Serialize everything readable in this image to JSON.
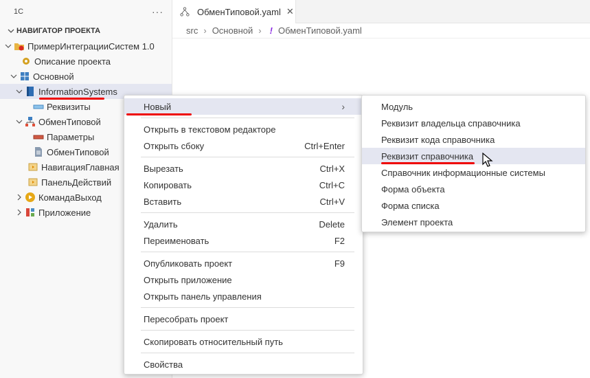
{
  "sidebar": {
    "header": "1С",
    "more": "···",
    "section": "НАВИГАТОР ПРОЕКТА",
    "tree": [
      {
        "label": "ПримерИнтеграцииСистем 1.0"
      },
      {
        "label": "Описание проекта"
      },
      {
        "label": "Основной"
      },
      {
        "label": "InformationSystems"
      },
      {
        "label": "Реквизиты"
      },
      {
        "label": "ОбменТиповой"
      },
      {
        "label": "Параметры"
      },
      {
        "label": "ОбменТиповой"
      },
      {
        "label": "НавигацияГлавная"
      },
      {
        "label": "ПанельДействий"
      },
      {
        "label": "КомандаВыход"
      },
      {
        "label": "Приложение"
      }
    ]
  },
  "tab": {
    "label": "ОбменТиповой.yaml"
  },
  "breadcrumb": {
    "a": "src",
    "b": "Основной",
    "mark": "!",
    "c": "ОбменТиповой.yaml"
  },
  "menu": {
    "new": "Новый",
    "open_text": "Открыть в текстовом редакторе",
    "open_side": "Открыть сбоку",
    "open_side_key": "Ctrl+Enter",
    "cut": "Вырезать",
    "cut_key": "Ctrl+X",
    "copy": "Копировать",
    "copy_key": "Ctrl+C",
    "paste": "Вставить",
    "paste_key": "Ctrl+V",
    "delete": "Удалить",
    "delete_key": "Delete",
    "rename": "Переименовать",
    "rename_key": "F2",
    "publish": "Опубликовать проект",
    "publish_key": "F9",
    "open_app": "Открыть приложение",
    "open_panel": "Открыть панель управления",
    "rebuild": "Пересобрать проект",
    "copy_path": "Скопировать относительный путь",
    "properties": "Свойства"
  },
  "submenu": [
    "Модуль",
    "Реквизит владельца справочника",
    "Реквизит кода справочника",
    "Реквизит справочника",
    "Справочник информационные системы",
    "Форма объекта",
    "Форма списка",
    "Элемент проекта"
  ],
  "colors": {
    "highlight": "#e4e6f1",
    "underline": "#e00000"
  }
}
